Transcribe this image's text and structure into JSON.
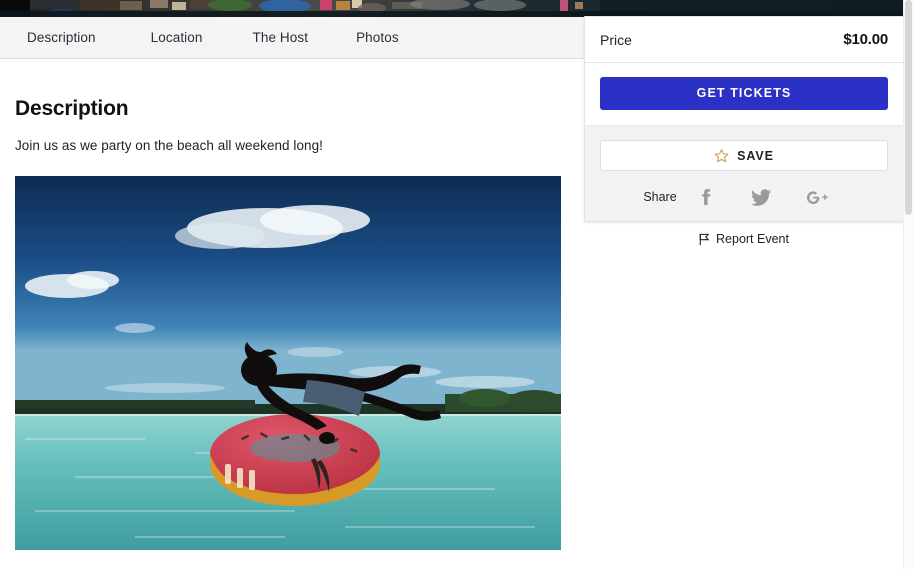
{
  "hero": {
    "alt": "beach-crowd-banner",
    "description": "Dark aerial photo strip of a crowded beach with umbrellas and ocean"
  },
  "tabs": [
    {
      "label": "Description",
      "name": "tab-description"
    },
    {
      "label": "Location",
      "name": "tab-location"
    },
    {
      "label": "The Host",
      "name": "tab-the-host"
    },
    {
      "label": "Photos",
      "name": "tab-photos"
    }
  ],
  "main": {
    "section_title": "Description",
    "section_body": "Join us as we party on the beach all weekend long!",
    "photo_alt": "person-diving-onto-donut-float"
  },
  "sidebar": {
    "price_label": "Price",
    "price_value": "$10.00",
    "get_tickets_label": "GET TICKETS",
    "save_label": "SAVE",
    "share_label": "Share",
    "share_icons": [
      {
        "name": "facebook-icon",
        "glyph": "f"
      },
      {
        "name": "twitter-icon",
        "glyph": "bird"
      },
      {
        "name": "google-plus-icon",
        "glyph": "G+"
      }
    ],
    "report_label": "Report Event",
    "report_icon": "flag-icon"
  },
  "colors": {
    "accent_blue": "#2b31c4",
    "star_gold": "#d2a45f",
    "tabbar_bg": "#f4f4f4",
    "share_bg": "#f2f2f2",
    "text_dark": "#20232c",
    "icon_gray": "#9a9a9a"
  }
}
